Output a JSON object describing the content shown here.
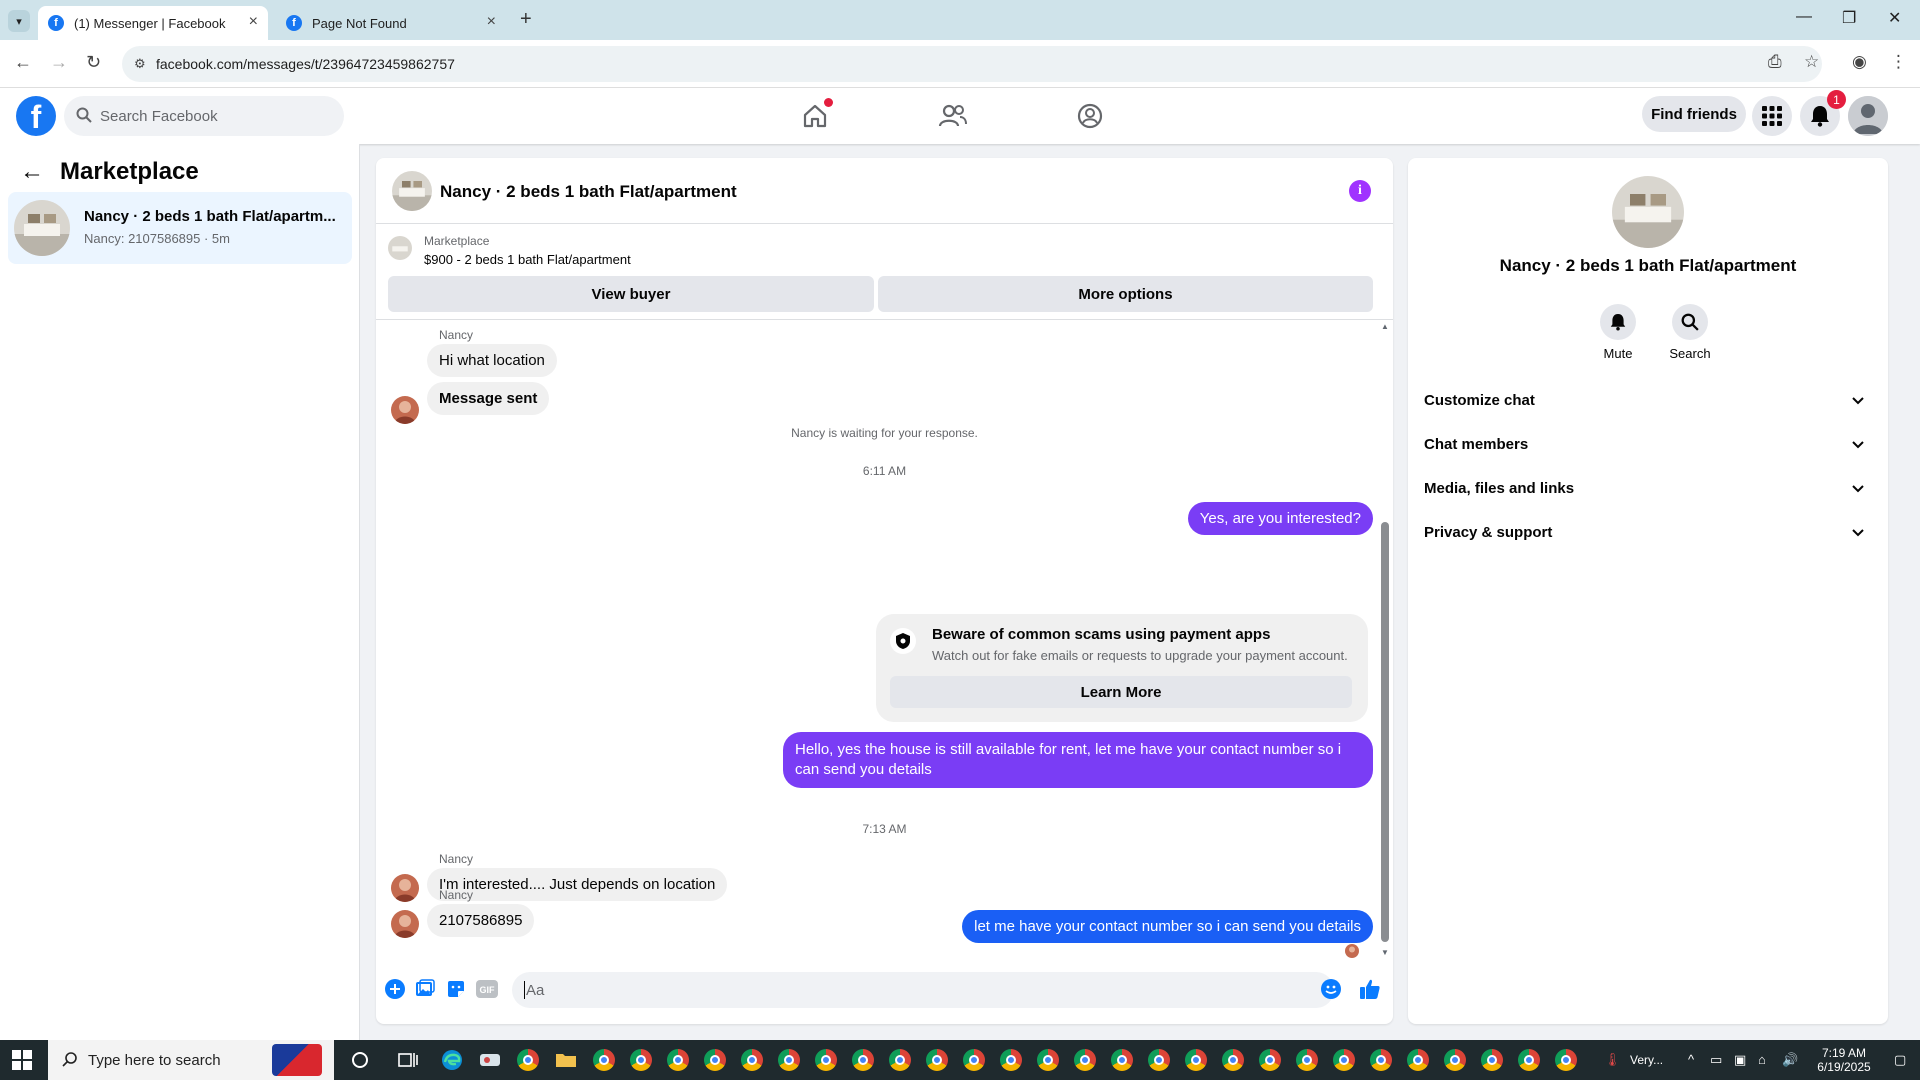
{
  "browser": {
    "tabs": [
      {
        "title": "(1) Messenger | Facebook",
        "active": true
      },
      {
        "title": "Page Not Found",
        "active": false
      }
    ],
    "url": "facebook.com/messages/t/23964723459862757"
  },
  "fb_header": {
    "search_placeholder": "Search Facebook",
    "find_friends_label": "Find friends",
    "notification_count": "1",
    "brand_color": "#1877f2"
  },
  "left_panel": {
    "title": "Marketplace",
    "conversations": [
      {
        "title": "Nancy · 2 beds 1 bath Flat/apartm...",
        "preview": "Nancy: 2107586895 · 5m"
      }
    ]
  },
  "chat": {
    "title": "Nancy · 2 beds 1 bath Flat/apartment",
    "marketplace_label": "Marketplace",
    "listing": "$900 - 2 beds 1 bath Flat/apartment",
    "view_buyer_label": "View buyer",
    "more_options_label": "More options",
    "messages": {
      "sender1": "Nancy",
      "m1": "Hi what location",
      "m2": "Message sent",
      "waiting": "Nancy is waiting for your response.",
      "time1": "6:11 AM",
      "out1": "Yes, are you interested?",
      "scam_title": "Beware of common scams using payment apps",
      "scam_sub": "Watch out for fake emails or requests to upgrade your payment account.",
      "scam_button": "Learn More",
      "out2": "Hello, yes the house is still available for rent, let me have your contact number so i can send you details",
      "time2": "7:13 AM",
      "sender2": "Nancy",
      "m3": "I'm interested.... Just depends on location",
      "out3": "let me have your contact number so i can send you details",
      "sender3": "Nancy",
      "m4": "2107586895"
    },
    "composer_placeholder": "Aa",
    "outgoing_color": "#7a3df5"
  },
  "right_panel": {
    "title": "Nancy · 2 beds 1 bath Flat/apartment",
    "actions": [
      {
        "label": "Mute"
      },
      {
        "label": "Search"
      }
    ],
    "sections": [
      {
        "label": "Customize chat"
      },
      {
        "label": "Chat members"
      },
      {
        "label": "Media, files and links"
      },
      {
        "label": "Privacy & support"
      }
    ]
  },
  "taskbar": {
    "search_placeholder": "Type here to search",
    "weather": "Very...",
    "time": "7:19 AM",
    "date": "6/19/2025"
  }
}
